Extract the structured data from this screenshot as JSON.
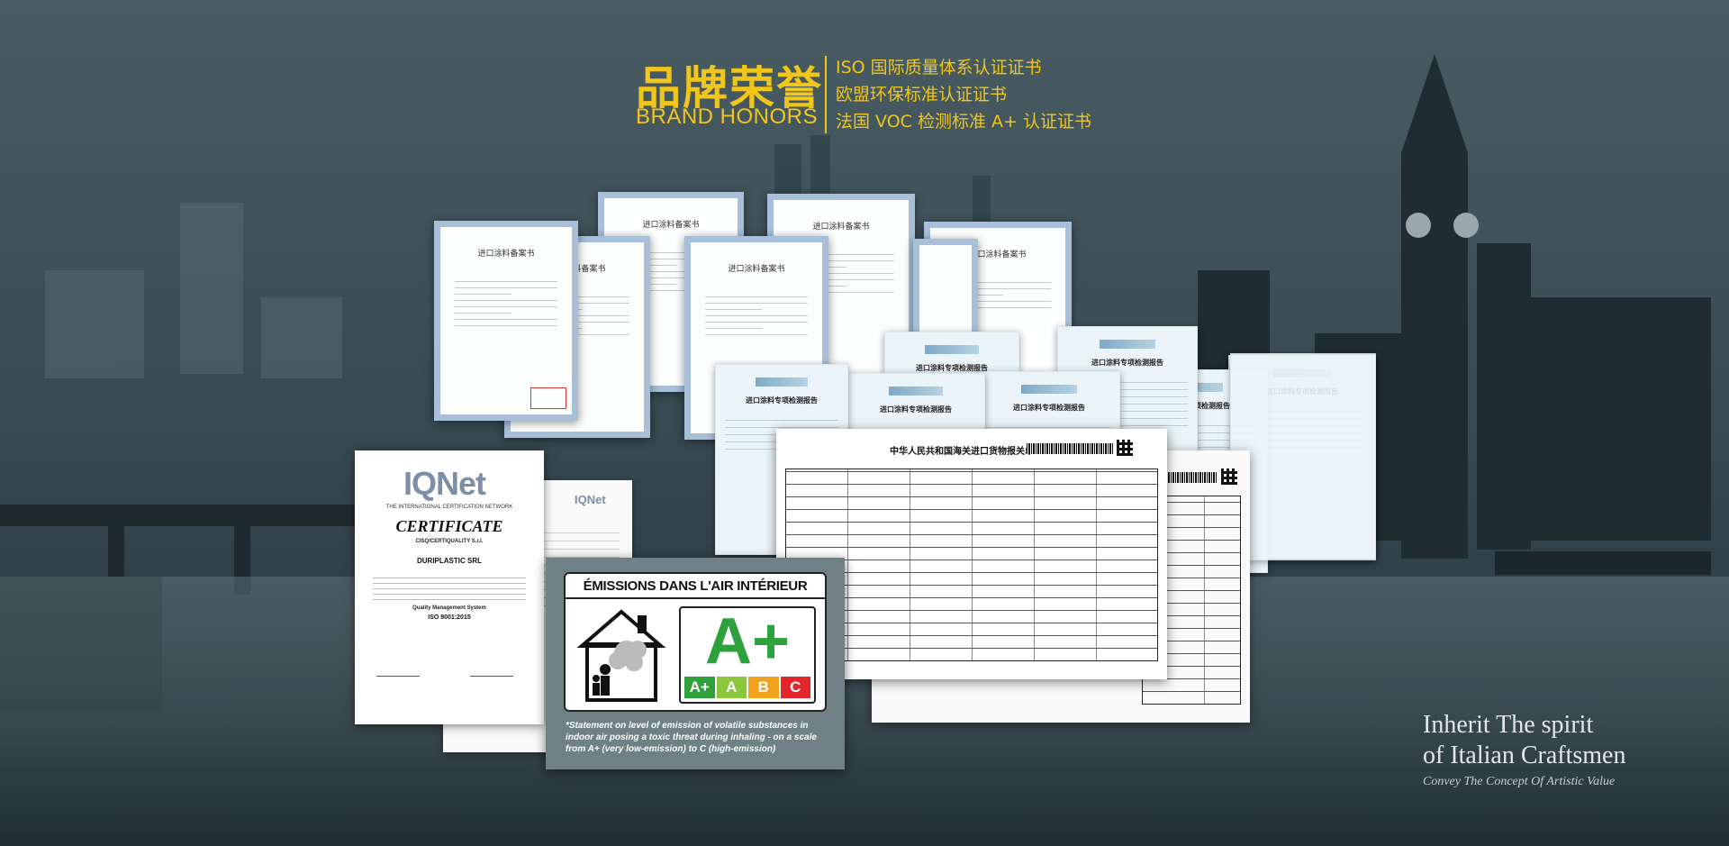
{
  "header": {
    "title_cn": "品牌荣誉",
    "title_en": "BRAND HONORS",
    "certs": [
      "ISO 国际质量体系认证证书",
      "欧盟环保标准认证证书",
      "法国 VOC 检测标准  A+ 认证证书"
    ]
  },
  "documents": {
    "filing_head": "进口涂料备案书",
    "report_head": "进口涂料专项检测报告",
    "customs_title": "中华人民共和国海关进口货物报关单"
  },
  "iqnet": {
    "logo": "IQNet",
    "network": "THE INTERNATIONAL CERTIFICATION NETWORK",
    "certificate": "CERTIFICATE",
    "issuer": "CISQ/CERTIQUALITY S.r.l.",
    "company": "DURIPLASTIC SRL",
    "system": "Quality Management System",
    "standard": "ISO 9001:2015"
  },
  "emissions": {
    "title": "ÉMISSIONS DANS L'AIR INTÉRIEUR",
    "grade": "A+",
    "scale": [
      {
        "label": "A+",
        "color": "#2ea03c"
      },
      {
        "label": "A",
        "color": "#8cc63e"
      },
      {
        "label": "B",
        "color": "#f2a21d"
      },
      {
        "label": "C",
        "color": "#e3262b"
      }
    ],
    "note": "*Statement on level of emission of volatile substances in indoor air posing a toxic threat during inhaling - on a scale from A+ (very low-emission) to C (high-emission)"
  },
  "slogan": {
    "line1": "Inherit The spirit",
    "line2": "of Italian Craftsmen",
    "line3": "Convey The Concept Of Artistic Value"
  },
  "colors": {
    "accent": "#f0c51c",
    "background": "#34474f"
  }
}
